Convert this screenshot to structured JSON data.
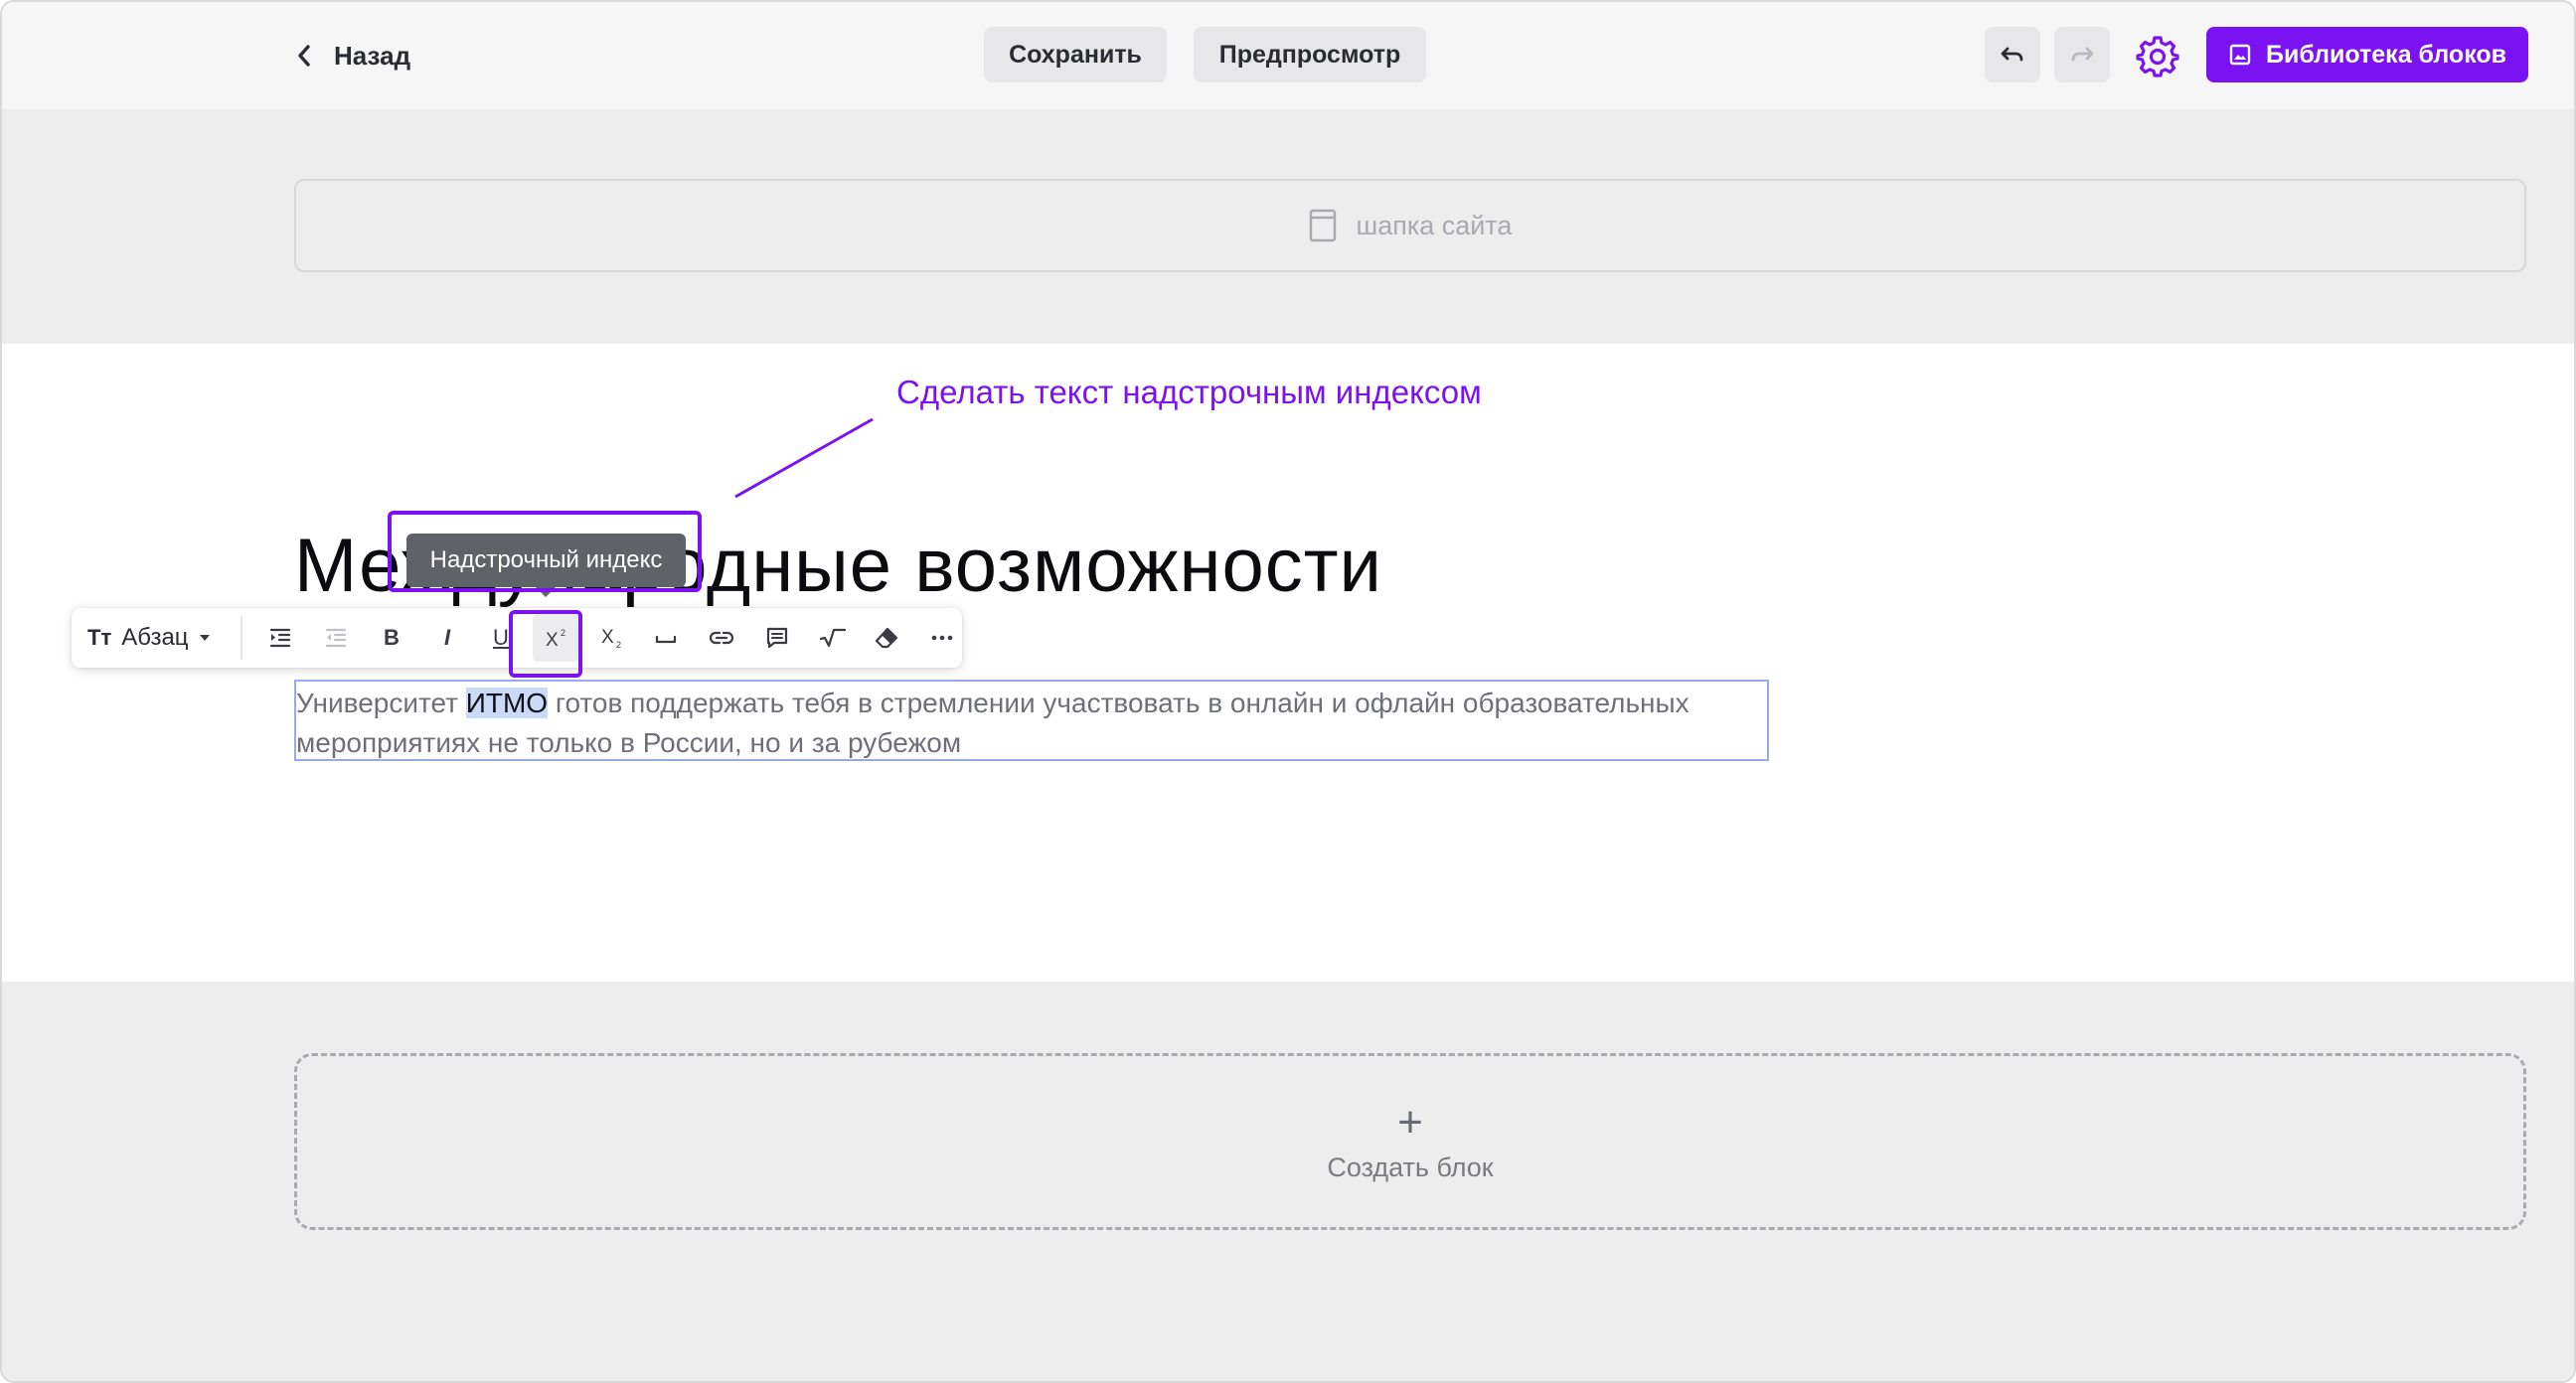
{
  "topbar": {
    "back_label": "Назад",
    "save_label": "Сохранить",
    "preview_label": "Предпросмотр",
    "library_label": "Библиотека блоков"
  },
  "colors": {
    "accent": "#7b12f2",
    "selection": "#c9dbf6",
    "tooltip_bg": "#5f6266"
  },
  "header_placeholder": {
    "label": "шапка сайта",
    "icon": "page-icon"
  },
  "annotation": {
    "text": "Сделать текст надстрочным индексом"
  },
  "page": {
    "heading": "Международные возможности",
    "paragraph_before": "Университет ",
    "paragraph_selected": "ИТМО",
    "paragraph_after": " готов поддержать тебя в стремлении участвовать в онлайн и офлайн образовательных мероприятиях не только в России, но и за рубежом"
  },
  "toolbar": {
    "paragraph_style": "Абзац",
    "tooltip": "Надстрочный индекс",
    "bold": "B",
    "italic": "I",
    "underline": "U",
    "buttons": [
      "indent-icon",
      "outdent-icon",
      "bold-icon",
      "italic-icon",
      "underline-icon",
      "superscript-icon",
      "subscript-icon",
      "nbsp-icon",
      "link-icon",
      "comment-icon",
      "formula-icon",
      "eraser-icon",
      "more-icon"
    ]
  },
  "create_block": {
    "label": "Создать блок"
  }
}
